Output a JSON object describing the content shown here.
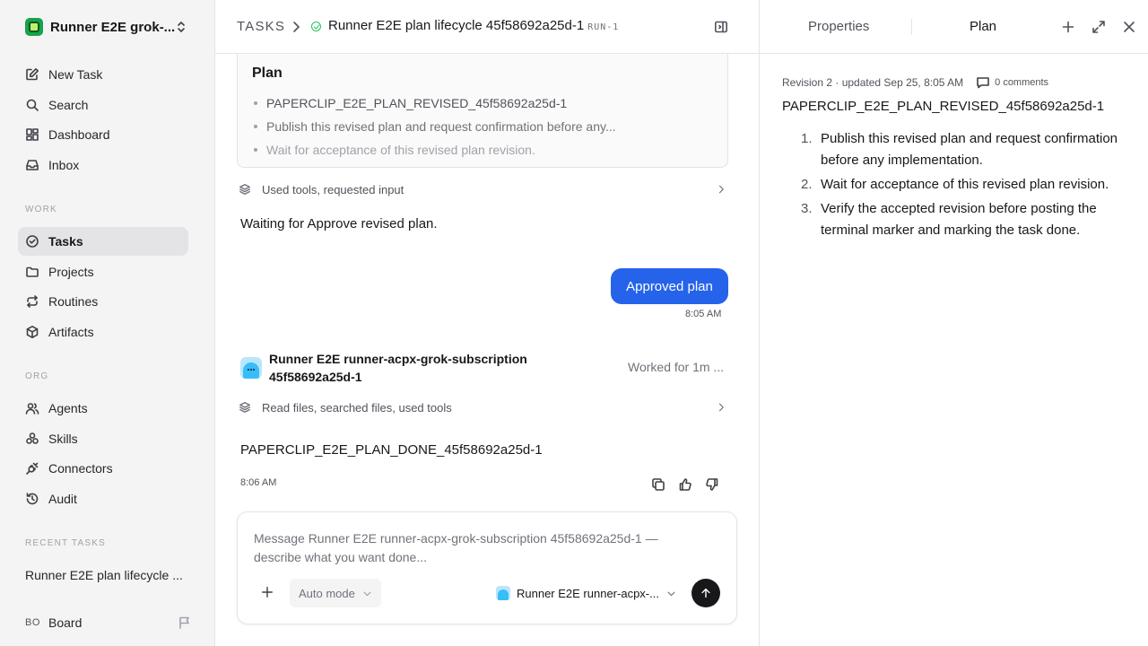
{
  "workspace": {
    "name": "Runner E2E grok-..."
  },
  "sidebar": {
    "top_items": [
      {
        "label": "New Task",
        "icon": "pencil-square-icon"
      },
      {
        "label": "Search",
        "icon": "search-icon"
      },
      {
        "label": "Dashboard",
        "icon": "dashboard-grid-icon"
      },
      {
        "label": "Inbox",
        "icon": "inbox-icon"
      }
    ],
    "work_label": "WORK",
    "work_items": [
      {
        "label": "Tasks",
        "icon": "check-circle-icon",
        "active": true
      },
      {
        "label": "Projects",
        "icon": "folder-icon"
      },
      {
        "label": "Routines",
        "icon": "repeat-icon"
      },
      {
        "label": "Artifacts",
        "icon": "cube-icon"
      }
    ],
    "org_label": "ORG",
    "org_items": [
      {
        "label": "Agents",
        "icon": "users-icon"
      },
      {
        "label": "Skills",
        "icon": "sparkle-cluster-icon"
      },
      {
        "label": "Connectors",
        "icon": "plug-icon"
      },
      {
        "label": "Audit",
        "icon": "history-icon"
      }
    ],
    "recent_label": "RECENT TASKS",
    "recent_item": "Runner E2E plan lifecycle ...",
    "board": {
      "avatar": "BO",
      "label": "Board"
    }
  },
  "header": {
    "crumb_root": "TASKS",
    "task_title": "Runner E2E plan lifecycle 45f58692a25d-1",
    "run_tag": "RUN-1"
  },
  "thread": {
    "plan_card": {
      "title": "Plan",
      "items": [
        "PAPERCLIP_E2E_PLAN_REVISED_45f58692a25d-1",
        "Publish this revised plan and request confirmation before any...",
        "Wait for acceptance of this revised plan revision."
      ]
    },
    "tools_row_1": "Used tools, requested input",
    "waiting_text": "Waiting for Approve revised plan.",
    "user_bubble": {
      "text": "Approved plan",
      "time": "8:05 AM"
    },
    "agent": {
      "name": "Runner E2E runner-acpx-grok-subscription 45f58692a25d-1",
      "worked": "Worked for 1m ..."
    },
    "tools_row_2": "Read files, searched files, used tools",
    "agent_message": "PAPERCLIP_E2E_PLAN_DONE_45f58692a25d-1",
    "agent_time": "8:06 AM"
  },
  "composer": {
    "placeholder": "Message Runner E2E runner-acpx-grok-subscription 45f58692a25d-1 — describe what you want done...",
    "mode": "Auto mode",
    "agent_select": "Runner E2E runner-acpx-..."
  },
  "right_panel": {
    "tabs": {
      "properties": "Properties",
      "plan": "Plan"
    },
    "revision": "Revision 2 · updated Sep 25, 8:05 AM",
    "comments": "0 comments",
    "plan_title": "PAPERCLIP_E2E_PLAN_REVISED_45f58692a25d-1",
    "steps": [
      {
        "num": "1.",
        "text": "Publish this revised plan and request confirmation before any implementation."
      },
      {
        "num": "2.",
        "text": "Wait for acceptance of this revised plan revision."
      },
      {
        "num": "3.",
        "text": "Verify the accepted revision before posting the terminal marker and marking the task done."
      }
    ]
  },
  "colors": {
    "accent": "#2563eb",
    "success": "#22c55e",
    "sidebar_bg": "#f4f4f5"
  }
}
